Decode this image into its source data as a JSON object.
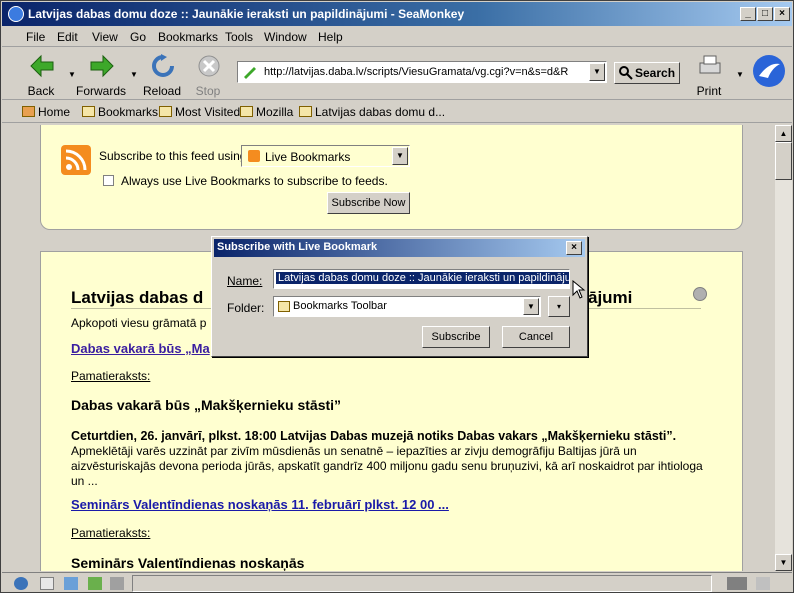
{
  "window": {
    "title": "Latvijas dabas domu doze :: Jaunākie ieraksti un papildinājumi - SeaMonkey"
  },
  "menu": [
    "File",
    "Edit",
    "View",
    "Go",
    "Bookmarks",
    "Tools",
    "Window",
    "Help"
  ],
  "nav": {
    "back": "Back",
    "forward": "Forwards",
    "reload": "Reload",
    "stop": "Stop",
    "print": "Print"
  },
  "url": "http://latvijas.daba.lv/scripts/ViesuGramata/vg.cgi?v=n&s=d&R",
  "search_label": "Search",
  "bookmarks": [
    "Home",
    "Bookmarks",
    "Most Visited",
    "Mozilla",
    "Latvijas dabas domu d..."
  ],
  "feed": {
    "subscribe_label": "Subscribe to this feed using",
    "reader": "Live Bookmarks",
    "always_label": "Always use Live Bookmarks to subscribe to feeds.",
    "subscribe_now": "Subscribe Now"
  },
  "page": {
    "heading_left": "Latvijas dabas d",
    "heading_right": "ājumi",
    "subtitle": "Apkopoti viesu grāmatā p",
    "link1": "Dabas vakarā būs „Ma",
    "pamat1": "Pamatieraksts:",
    "post1_title": "Dabas vakarā būs „Makšķernieku stāsti”",
    "post1_lead": "Ceturtdien, 26. janvārī, plkst. 18:00 Latvijas Dabas muzejā notiks Dabas vakars „Makšķernieku stāsti”.",
    "post1_text1": "Apmeklētāji varēs uzzināt par zivīm mūsdienās un senatnē – iepazīties ar zivju demogrāfiju Baltijas jūrā un",
    "post1_text2": "aizvēsturiskajās devona perioda jūrās, apskatīt gandrīz 400 miljonu gadu senu bruņuzivi, kā arī noskaidrot par ihtiologa",
    "post1_text3": "un ...",
    "link2": "Seminārs Valentīndienas noskaņās 11. februārī plkst. 12 00 ...",
    "pamat2": "Pamatieraksts:",
    "post2_title": "Seminārs Valentīndienas noskaņās"
  },
  "dialog": {
    "title": "Subscribe with Live Bookmark",
    "name_label": "Name:",
    "name_value": "Latvijas dabas domu doze :: Jaunākie ieraksti un papildinājumi",
    "folder_label": "Folder:",
    "folder_value": "Bookmarks Toolbar",
    "subscribe": "Subscribe",
    "cancel": "Cancel"
  }
}
